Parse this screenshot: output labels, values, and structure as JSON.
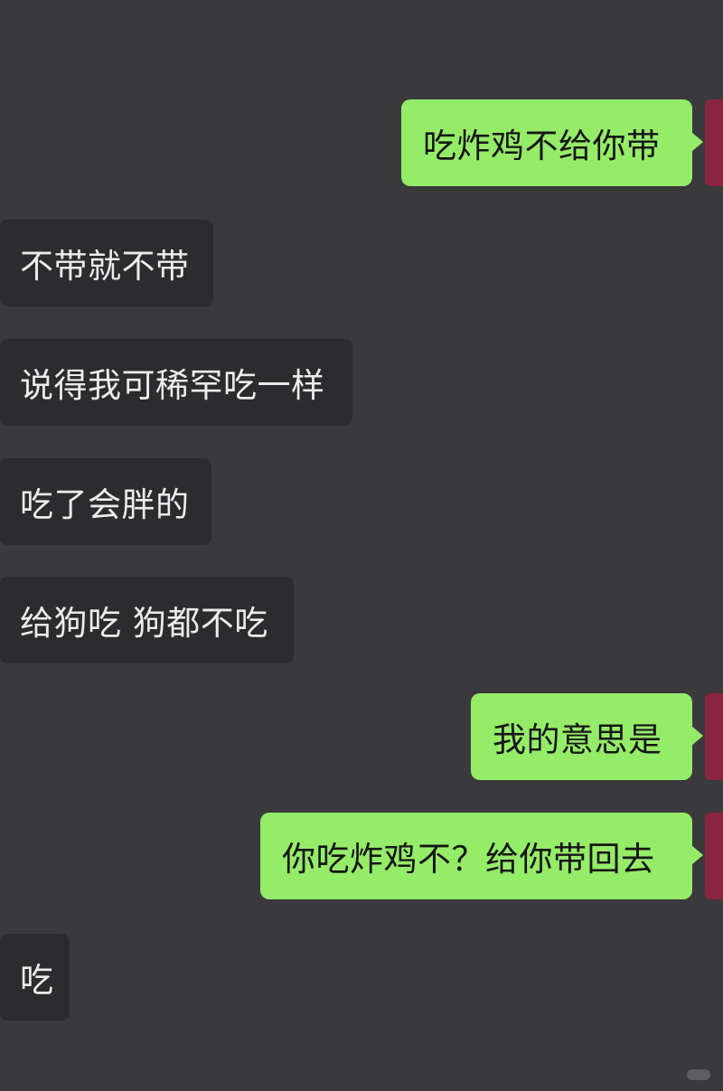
{
  "messages": [
    {
      "side": "out",
      "text": "吃炸鸡不给你带"
    },
    {
      "side": "in",
      "text": "不带就不带"
    },
    {
      "side": "in",
      "text": "说得我可稀罕吃一样"
    },
    {
      "side": "in",
      "text": "吃了会胖的"
    },
    {
      "side": "in",
      "text": "给狗吃 狗都不吃"
    },
    {
      "side": "out",
      "text": "我的意思是"
    },
    {
      "side": "out",
      "text": "你吃炸鸡不？给你带回去"
    },
    {
      "side": "in",
      "text": "吃"
    }
  ],
  "colors": {
    "background": "#3a3a3c",
    "incoming_bubble": "#2c2c2e",
    "outgoing_bubble": "#95ec69",
    "avatar": "#8a2440"
  }
}
